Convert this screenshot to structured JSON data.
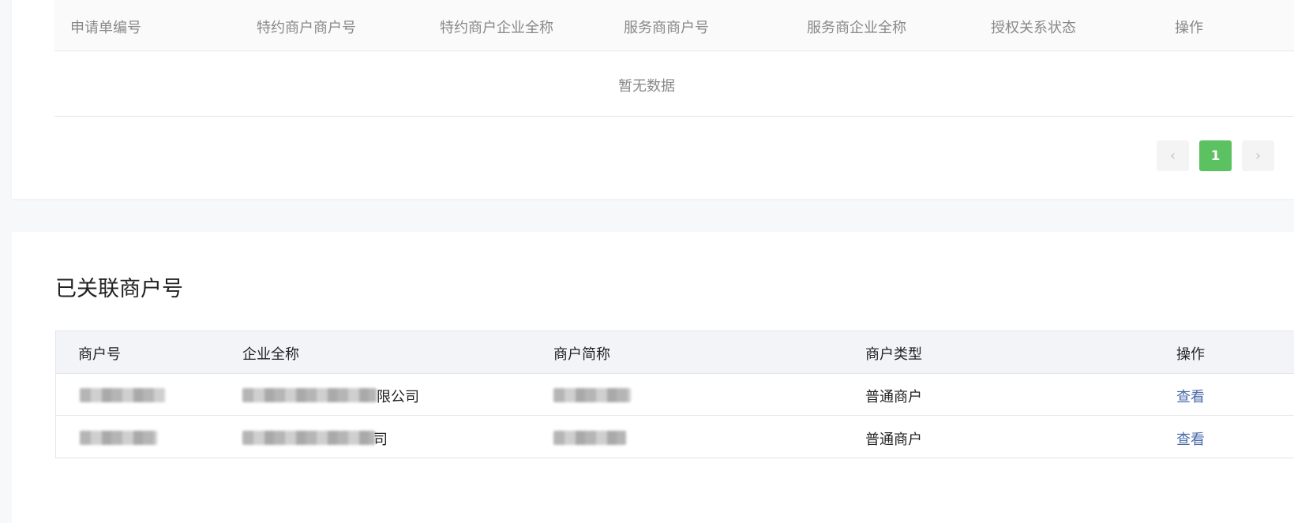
{
  "auth_table": {
    "columns": [
      "申请单编号",
      "特约商户商户号",
      "特约商户企业全称",
      "服务商商户号",
      "服务商企业全称",
      "授权关系状态",
      "操作"
    ],
    "empty_text": "暂无数据",
    "pagination": {
      "prev_icon": "‹",
      "current_page": "1",
      "next_icon": "›"
    }
  },
  "linked": {
    "title": "已关联商户号",
    "columns": [
      "商户号",
      "企业全称",
      "商户简称",
      "商户类型",
      "操作"
    ],
    "rows": [
      {
        "merchant_type": "普通商户",
        "action": "查看"
      },
      {
        "merchant_type": "普通商户",
        "action": "查看"
      }
    ],
    "redaction_note": "",
    "row1_company_suffix": "限公司",
    "row2_company_suffix": "司"
  },
  "colors": {
    "accent": "#5cc160",
    "link": "#4a6aa8"
  }
}
